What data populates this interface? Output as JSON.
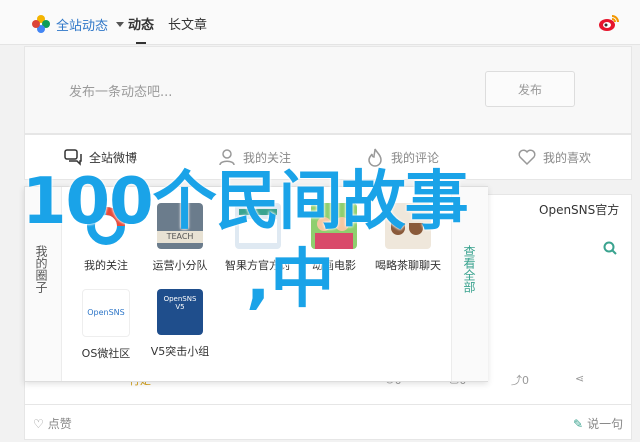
{
  "topbar": {
    "brand_label": "全站动态",
    "tabs": [
      "动态",
      "长文章"
    ],
    "colors": {
      "brand": "#2f77c8"
    }
  },
  "composer": {
    "placeholder": "发布一条动态吧...",
    "publish_label": "发布"
  },
  "filters": [
    {
      "label": "全站微博",
      "icon": "chat-bubbles-icon"
    },
    {
      "label": "我的关注",
      "icon": "person-icon"
    },
    {
      "label": "我的评论",
      "icon": "flame-icon"
    },
    {
      "label": "我的喜欢",
      "icon": "heart-icon"
    }
  ],
  "sidebar_card": {
    "title": "OpenSNS官方"
  },
  "popup": {
    "left_label": "我的圈子",
    "right_link": "查看全部",
    "apps": [
      {
        "label": "我的关注",
        "icon": "donut-chart-icon"
      },
      {
        "label": "运营小分队",
        "icon": "team-photo-icon",
        "icon_text": "TEACH"
      },
      {
        "label": "智果方官方讨",
        "icon": "screenshot-icon"
      },
      {
        "label": "动画电影",
        "icon": "cartoon-kids-icon"
      },
      {
        "label": "喝略茶聊聊天",
        "icon": "tea-cups-icon"
      },
      {
        "label": "OS微社区",
        "icon": "opensns-logo-icon",
        "icon_text": "OpenSNS"
      },
      {
        "label": "V5突击小组",
        "icon": "opensns-v5-icon",
        "icon_text": "OpenSNS V5"
      }
    ]
  },
  "overlay": {
    "title": "100个民间故事",
    "subtitle": ",中"
  },
  "feed_actions": {
    "tag": "行走",
    "views": "0",
    "comments": "0",
    "reposts": "0"
  },
  "likebar": {
    "like_label": "点赞",
    "say_label": "说一句"
  }
}
